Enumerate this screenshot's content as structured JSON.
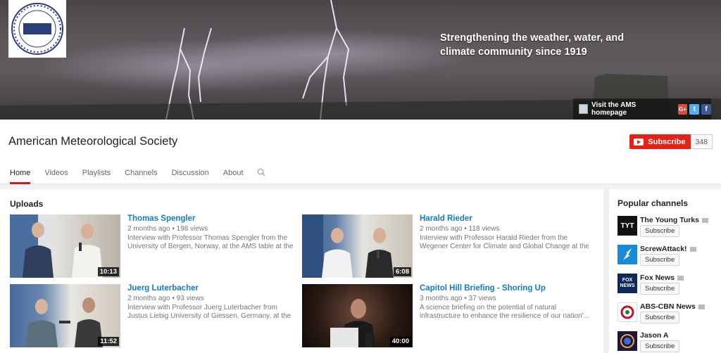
{
  "banner": {
    "logo_alt": "American Meteorological Society",
    "tagline_line1": "Strengthening the weather, water, and",
    "tagline_line2": "climate community since 1919",
    "home_link": "Visit the AMS homepage",
    "social": [
      "G+",
      "t",
      "f"
    ]
  },
  "channel": {
    "title": "American Meteorological Society",
    "subscribe_label": "Subscribe",
    "subscriber_count": "348"
  },
  "tabs": [
    {
      "label": "Home",
      "active": true
    },
    {
      "label": "Videos"
    },
    {
      "label": "Playlists"
    },
    {
      "label": "Channels"
    },
    {
      "label": "Discussion"
    },
    {
      "label": "About"
    }
  ],
  "uploads": {
    "title": "Uploads",
    "videos": [
      {
        "title": "Thomas Spengler",
        "age": "2 months ago",
        "views": "198 views",
        "desc1": "Interview with Professor Thomas Spengler from the",
        "desc2": "University of Bergen, Norway, at the AMS table at the",
        "duration": "10:13"
      },
      {
        "title": "Harald Rieder",
        "age": "2 months ago",
        "views": "118 views",
        "desc1": "Interview with Professor Harald Rieder from the",
        "desc2": "Wegener Center for Climate and Global Change at the...",
        "duration": "6:08"
      },
      {
        "title": "Juerg Luterbacher",
        "age": "2 months ago",
        "views": "93 views",
        "desc1": "Interview with Professor Juerg Luterbacher from",
        "desc2": "Justus Liebig University of Giessen, Germany, at the",
        "duration": "11:52"
      },
      {
        "title": "Capitol Hill Briefing - Shoring Up",
        "age": "3 months ago",
        "views": "37 views",
        "desc1": "A science briefing on the potential of natural",
        "desc2": "infrastructure to enhance the resilience of our nation'...",
        "duration": "40:00"
      }
    ]
  },
  "sidebar": {
    "title": "Popular channels",
    "subscribe_label": "Subscribe",
    "channels": [
      {
        "name": "The Young Turks",
        "avatar_text": "TYT",
        "color": "#111111"
      },
      {
        "name": "ScrewAttack!",
        "avatar_text": "",
        "color": "#1a8ad8"
      },
      {
        "name": "Fox News",
        "avatar_text": "FOX NEWS",
        "color": "#0d2a5a"
      },
      {
        "name": "ABS-CBN News",
        "avatar_text": "",
        "color": "#c8102e"
      },
      {
        "name": "Jason A",
        "avatar_text": "",
        "color": "#1b1740"
      }
    ]
  }
}
